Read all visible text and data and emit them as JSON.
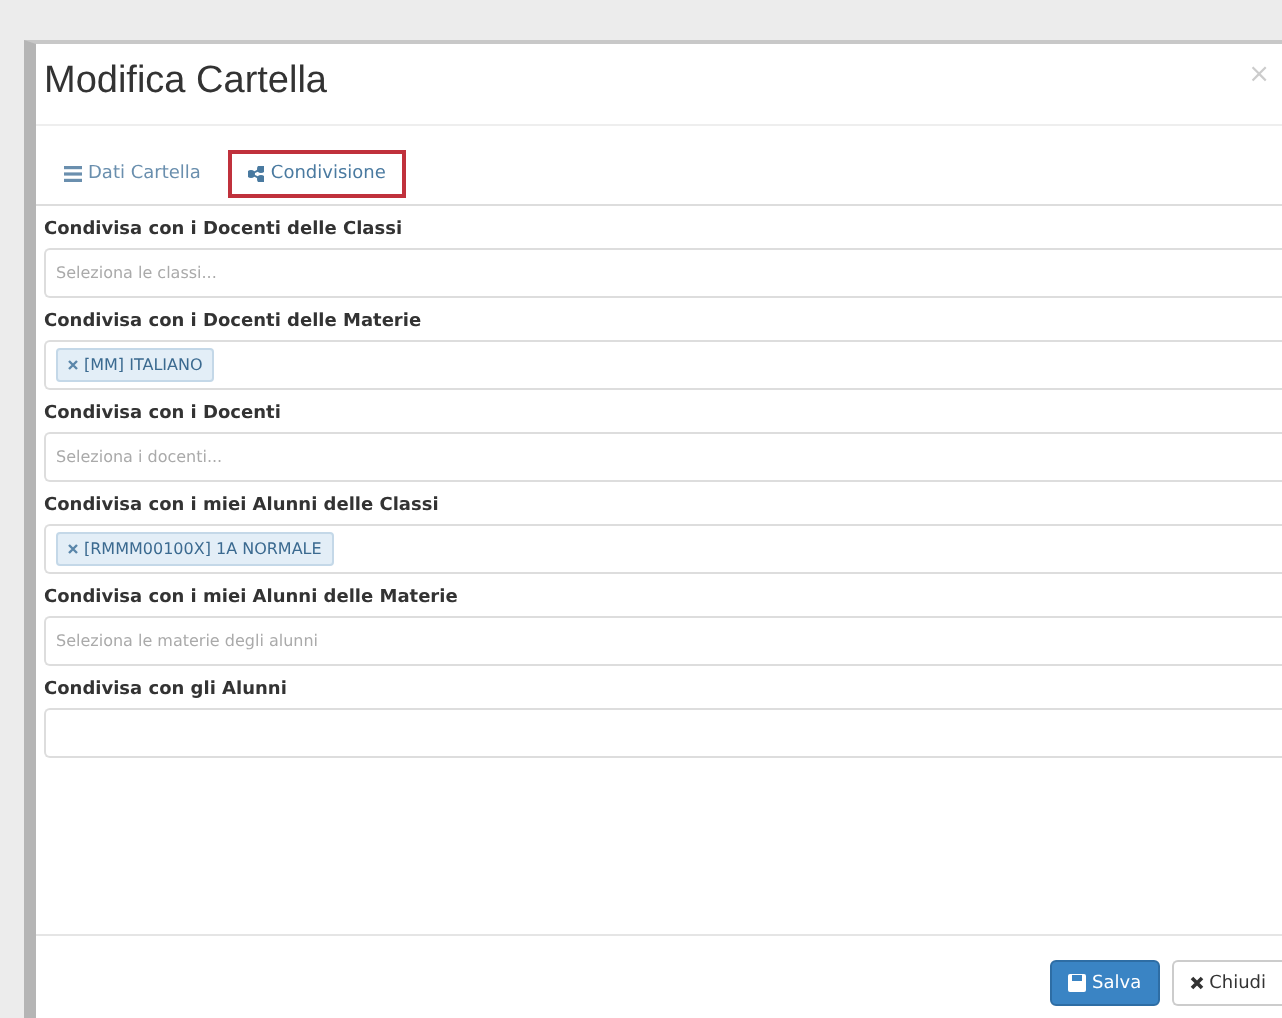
{
  "dialog": {
    "title": "Modifica Cartella",
    "close": "×"
  },
  "tabs": [
    {
      "label": "Dati Cartella",
      "selected": false
    },
    {
      "label": "Condivisione",
      "selected": true
    }
  ],
  "fields": [
    {
      "label": "Condivisa con i Docenti delle Classi",
      "kind": "select",
      "placeholder": "Seleziona le classi..."
    },
    {
      "label": "Condivisa con i Docenti delle Materie",
      "kind": "tags",
      "tags": [
        "[MM] ITALIANO"
      ]
    },
    {
      "label": "Condivisa con i Docenti",
      "kind": "select",
      "placeholder": "Seleziona i docenti..."
    },
    {
      "label": "Condivisa con i miei Alunni delle Classi",
      "kind": "tags",
      "tags": [
        "[RMMM00100X] 1A NORMALE"
      ]
    },
    {
      "label": "Condivisa con i miei Alunni delle Materie",
      "kind": "select",
      "placeholder": "Seleziona le materie degli alunni"
    },
    {
      "label": "Condivisa con gli Alunni",
      "kind": "text"
    }
  ],
  "buttons": [
    {
      "label": "Salva",
      "kind": "primary"
    },
    {
      "label": "Chiudi",
      "kind": "default"
    }
  ]
}
